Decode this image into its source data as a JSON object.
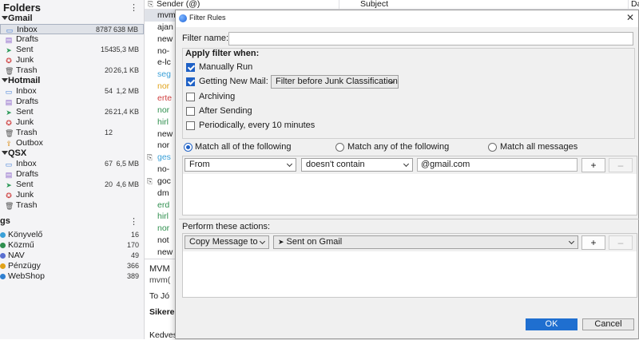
{
  "folder_pane": {
    "title": "Folders",
    "accounts": [
      {
        "name": "Gmail",
        "folders": [
          {
            "label": "Inbox",
            "icon": "inbox-icon",
            "count": "8787",
            "size": "638 MB",
            "selected": true
          },
          {
            "label": "Drafts",
            "icon": "drafts-icon",
            "count": "",
            "size": ""
          },
          {
            "label": "Sent",
            "icon": "sent-icon",
            "count": "154",
            "size": "35,3 MB"
          },
          {
            "label": "Junk",
            "icon": "junk-icon",
            "count": "",
            "size": ""
          },
          {
            "label": "Trash",
            "icon": "trash-icon",
            "count": "20",
            "size": "26,1 KB"
          }
        ]
      },
      {
        "name": "Hotmail",
        "folders": [
          {
            "label": "Inbox",
            "icon": "inbox-icon",
            "count": "54",
            "size": "1,2 MB"
          },
          {
            "label": "Drafts",
            "icon": "drafts-icon",
            "count": "",
            "size": ""
          },
          {
            "label": "Sent",
            "icon": "sent-icon",
            "count": "26",
            "size": "21,4 KB"
          },
          {
            "label": "Junk",
            "icon": "junk-icon",
            "count": "",
            "size": ""
          },
          {
            "label": "Trash",
            "icon": "trash-icon",
            "count": "12",
            "size": ""
          },
          {
            "label": "Outbox",
            "icon": "outbox-icon",
            "count": "",
            "size": ""
          }
        ]
      },
      {
        "name": "QSX",
        "folders": [
          {
            "label": "Inbox",
            "icon": "inbox-icon",
            "count": "67",
            "size": "6,5 MB"
          },
          {
            "label": "Drafts",
            "icon": "drafts-icon",
            "count": "",
            "size": ""
          },
          {
            "label": "Sent",
            "icon": "sent-icon",
            "count": "20",
            "size": "4,6 MB"
          },
          {
            "label": "Junk",
            "icon": "junk-icon",
            "count": "",
            "size": ""
          },
          {
            "label": "Trash",
            "icon": "trash-icon",
            "count": "",
            "size": ""
          }
        ]
      }
    ],
    "tags_title": "gs",
    "tags": [
      {
        "label": "Könyvelő",
        "count": "16",
        "color": "#3aa0d8"
      },
      {
        "label": "Közmű",
        "count": "170",
        "color": "#2f8f4e"
      },
      {
        "label": "NAV",
        "count": "49",
        "color": "#5a6fd0"
      },
      {
        "label": "Pénzügy",
        "count": "366",
        "color": "#e0a21a"
      },
      {
        "label": "WebShop",
        "count": "389",
        "color": "#2f7fd0"
      }
    ]
  },
  "message_list": {
    "columns": {
      "sender": "Sender (@)",
      "subject": "Subject",
      "date": "Da"
    },
    "rows": [
      {
        "text": "mvm",
        "color": "#1a1a1a",
        "attach": false,
        "selected": true
      },
      {
        "text": "ajan",
        "color": "#1a1a1a",
        "attach": false
      },
      {
        "text": "new",
        "color": "#1a1a1a",
        "attach": false
      },
      {
        "text": "no-",
        "color": "#1a1a1a",
        "attach": false
      },
      {
        "text": "e-lc",
        "color": "#1a1a1a",
        "attach": false
      },
      {
        "text": "seg",
        "color": "#3aa0d8",
        "attach": false
      },
      {
        "text": "nor",
        "color": "#e0a21a",
        "attach": false
      },
      {
        "text": "erte",
        "color": "#d04040",
        "attach": false
      },
      {
        "text": "nor",
        "color": "#2f8f4e",
        "attach": false
      },
      {
        "text": "hirl",
        "color": "#2f8f4e",
        "attach": false
      },
      {
        "text": "new",
        "color": "#1a1a1a",
        "attach": false
      },
      {
        "text": "nor",
        "color": "#1a1a1a",
        "attach": false
      },
      {
        "text": "ges",
        "color": "#3aa0d8",
        "attach": true
      },
      {
        "text": "no-",
        "color": "#1a1a1a",
        "attach": false
      },
      {
        "text": "goc",
        "color": "#1a1a1a",
        "attach": true
      },
      {
        "text": "dm",
        "color": "#1a1a1a",
        "attach": false
      },
      {
        "text": "erd",
        "color": "#2f8f4e",
        "attach": false
      },
      {
        "text": "hirl",
        "color": "#2f8f4e",
        "attach": false
      },
      {
        "text": "nor",
        "color": "#2f8f4e",
        "attach": false
      },
      {
        "text": "not",
        "color": "#1a1a1a",
        "attach": false
      },
      {
        "text": "new",
        "color": "#1a1a1a",
        "attach": false
      }
    ],
    "preview": {
      "title": "MVM",
      "from": "mvm(",
      "to": "To Jó",
      "subject": "Sikere",
      "body": "Kedves"
    }
  },
  "dialog": {
    "title": "Filter Rules",
    "filter_name_label": "Filter name:",
    "filter_name_value": "",
    "apply_when_label": "Apply filter when:",
    "apply_options": [
      {
        "label": "Manually Run",
        "checked": true
      },
      {
        "label": "Getting New Mail:",
        "checked": true
      },
      {
        "label": "Archiving",
        "checked": false
      },
      {
        "label": "After Sending",
        "checked": false
      },
      {
        "label": "Periodically, every 10 minutes",
        "checked": false
      }
    ],
    "new_mail_timing": "Filter before Junk Classification",
    "match_options": [
      {
        "label": "Match all of the following",
        "selected": true
      },
      {
        "label": "Match any of the following",
        "selected": false
      },
      {
        "label": "Match all messages",
        "selected": false
      }
    ],
    "rule": {
      "field": "From",
      "operator": "doesn't contain",
      "value": "@gmail.com"
    },
    "add_label": "+",
    "remove_label": "–",
    "actions_label": "Perform these actions:",
    "action": {
      "type": "Copy Message to",
      "target": "Sent on Gmail"
    },
    "ok_label": "OK",
    "cancel_label": "Cancel"
  },
  "colors": {
    "accent": "#1f6fd0",
    "selection": "#dfe2e8"
  }
}
